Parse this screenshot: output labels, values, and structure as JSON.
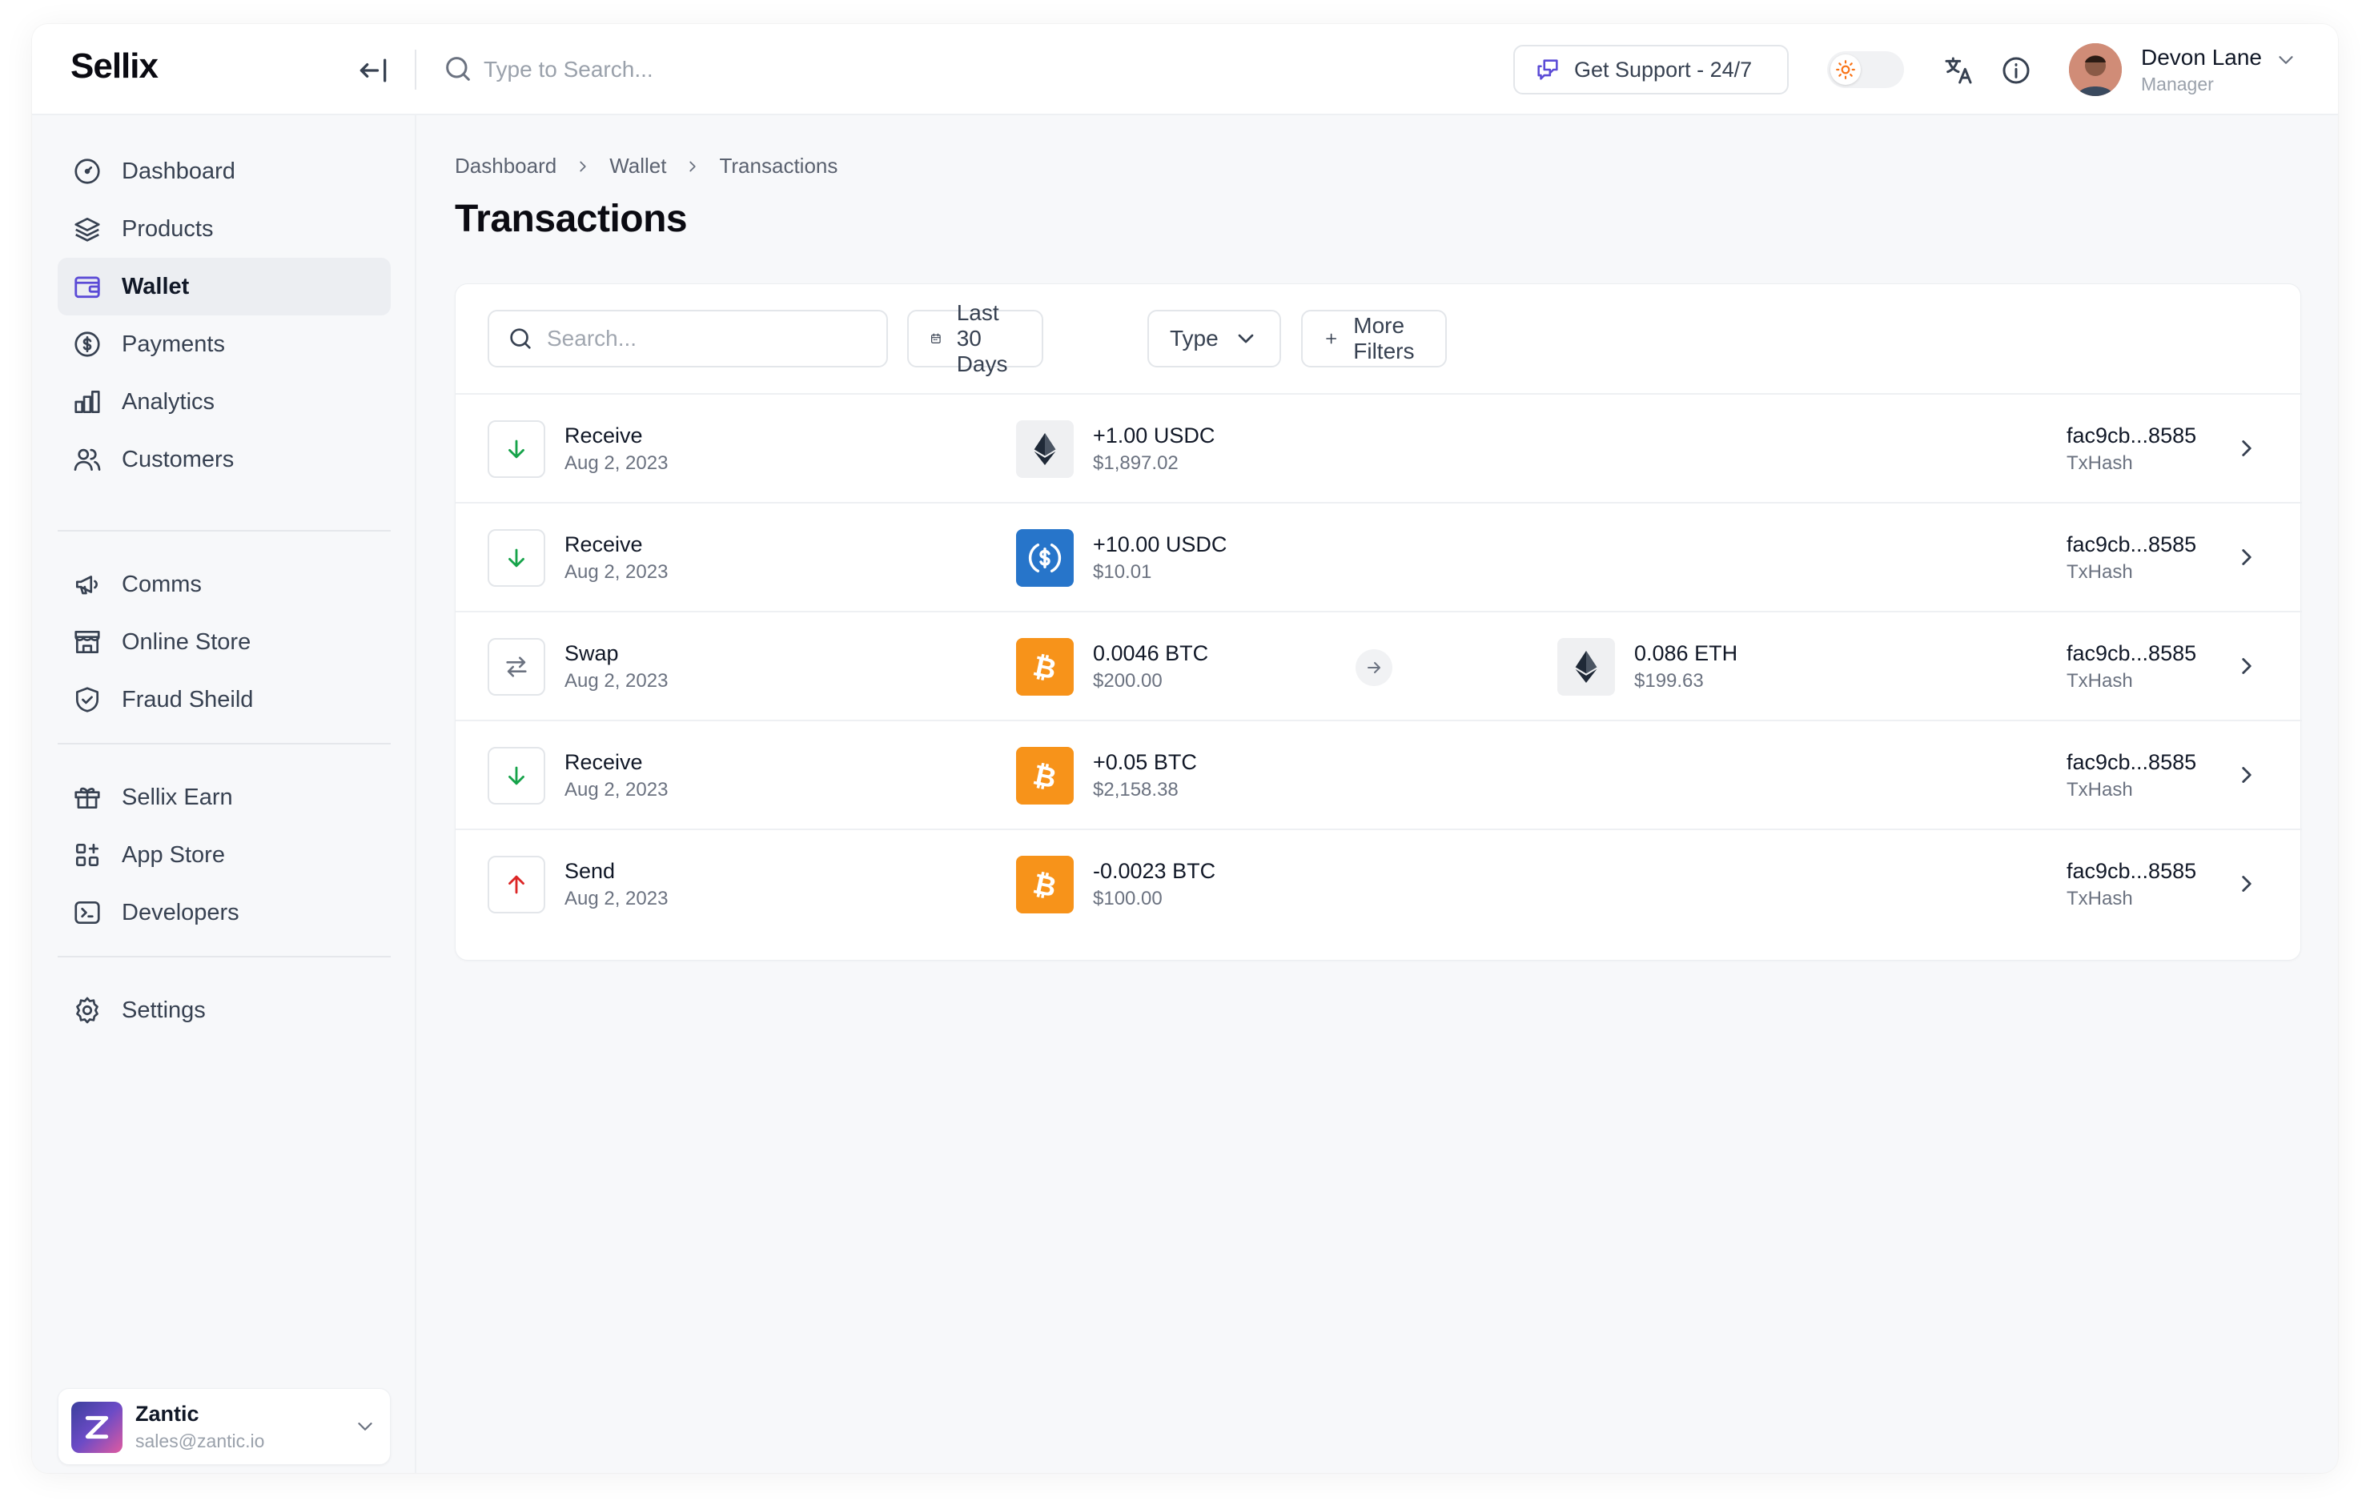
{
  "app": {
    "brand": "Sellix"
  },
  "topbar": {
    "search_placeholder": "Type to Search...",
    "support_label": "Get Support - 24/7",
    "user": {
      "name": "Devon Lane",
      "role": "Manager"
    }
  },
  "sidebar": {
    "items": [
      {
        "label": "Dashboard",
        "icon": "dashboard-icon"
      },
      {
        "label": "Products",
        "icon": "layers-icon"
      },
      {
        "label": "Wallet",
        "icon": "wallet-icon",
        "active": true
      },
      {
        "label": "Payments",
        "icon": "dollar-circle-icon"
      },
      {
        "label": "Analytics",
        "icon": "bar-chart-icon"
      },
      {
        "label": "Customers",
        "icon": "users-icon"
      },
      {
        "label": "Comms",
        "icon": "megaphone-icon"
      },
      {
        "label": "Online Store",
        "icon": "store-icon"
      },
      {
        "label": "Fraud Sheild",
        "icon": "shield-icon"
      },
      {
        "label": "Sellix Earn",
        "icon": "gift-icon"
      },
      {
        "label": "App Store",
        "icon": "apps-icon"
      },
      {
        "label": "Developers",
        "icon": "terminal-icon"
      },
      {
        "label": "Settings",
        "icon": "gear-icon"
      }
    ],
    "org": {
      "name": "Zantic",
      "email": "sales@zantic.io"
    }
  },
  "breadcrumb": [
    "Dashboard",
    "Wallet",
    "Transactions"
  ],
  "page_title": "Transactions",
  "filters": {
    "search_placeholder": "Search...",
    "date_label": "Last 30 Days",
    "type_label": "Type",
    "more_label": "More Filters"
  },
  "transactions": [
    {
      "type": "Receive",
      "date": "Aug 2, 2023",
      "direction": "down",
      "coin": "eth-icon",
      "amount": "+1.00 USDC",
      "usd": "$1,897.02",
      "hash": "fac9cb...8585",
      "hash_label": "TxHash"
    },
    {
      "type": "Receive",
      "date": "Aug 2, 2023",
      "direction": "down",
      "coin": "usdc-icon",
      "amount": "+10.00 USDC",
      "usd": "$10.01",
      "hash": "fac9cb...8585",
      "hash_label": "TxHash"
    },
    {
      "type": "Swap",
      "date": "Aug 2, 2023",
      "direction": "swap",
      "coin": "btc-icon",
      "amount": "0.0046 BTC",
      "usd": "$200.00",
      "to_coin": "eth-icon",
      "to_amount": "0.086 ETH",
      "to_usd": "$199.63",
      "hash": "fac9cb...8585",
      "hash_label": "TxHash"
    },
    {
      "type": "Receive",
      "date": "Aug 2, 2023",
      "direction": "down",
      "coin": "btc-icon",
      "amount": "+0.05 BTC",
      "usd": "$2,158.38",
      "hash": "fac9cb...8585",
      "hash_label": "TxHash"
    },
    {
      "type": "Send",
      "date": "Aug 2, 2023",
      "direction": "up",
      "coin": "btc-icon",
      "amount": "-0.0023 BTC",
      "usd": "$100.00",
      "hash": "fac9cb...8585",
      "hash_label": "TxHash"
    }
  ],
  "colors": {
    "accent": "#5b4bd6",
    "receive": "#16a34a",
    "send": "#dc2626",
    "usdc": "#2775ca",
    "btc": "#f7931a",
    "eth_bg": "#eff0f2"
  }
}
